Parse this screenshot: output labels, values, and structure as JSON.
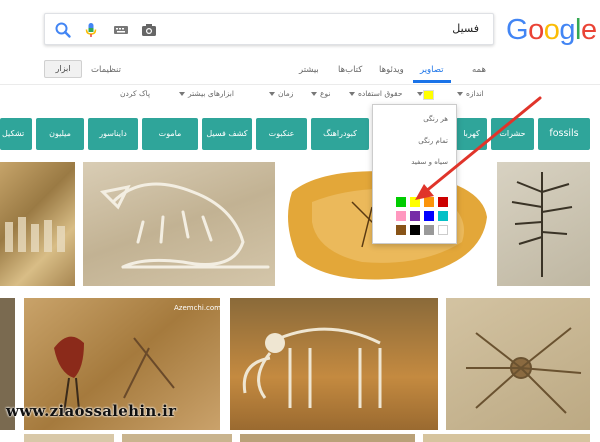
{
  "logo": {
    "text": "Google",
    "letters": [
      "G",
      "o",
      "o",
      "g",
      "l",
      "e"
    ],
    "colors": [
      "#4285f4",
      "#ea4335",
      "#fbbc05",
      "#4285f4",
      "#34a853",
      "#ea4335"
    ]
  },
  "search": {
    "query": "فسیل"
  },
  "icons": {
    "search": "search-icon",
    "mic": "microphone-icon",
    "keyboard": "keyboard-icon",
    "camera": "camera-icon"
  },
  "tabs": [
    "همه",
    "تصاویر",
    "ویدئوها",
    "کتاب‌ها",
    "بیشتر"
  ],
  "active_tab": "تصاویر",
  "settings_label": "تنظیمات",
  "tools_label": "ابزار",
  "filters": {
    "size": "اندازه",
    "usage_rights": "حقوق استفاده",
    "type": "نوع",
    "time": "زمان",
    "more_tools": "ابزارهای بیشتر",
    "clear": "پاک کردن"
  },
  "chips": [
    "fossils",
    "حشرات",
    "کهربا",
    "کبودراهنگ",
    "عنکبوت",
    "کشف فسیل",
    "ماموت",
    "دایناسور",
    "میلیون",
    "تشکیل"
  ],
  "color_menu": {
    "any_color": "هر رنگی",
    "full_color": "تمام رنگی",
    "black_white": "سیاه و سفید",
    "swatches": [
      "#cc0000",
      "#fb940b",
      "#ffff00",
      "#00cc00",
      "#03c0c6",
      "#0000ff",
      "#762ca7",
      "#ff98bf",
      "#ffffff",
      "#999999",
      "#000000",
      "#885418"
    ]
  },
  "accent_color": "#1a73e8",
  "chip_color": "#2fa59a",
  "watermark": "www.ziaossalehin.ir",
  "image_caption": "Azemchi.com"
}
